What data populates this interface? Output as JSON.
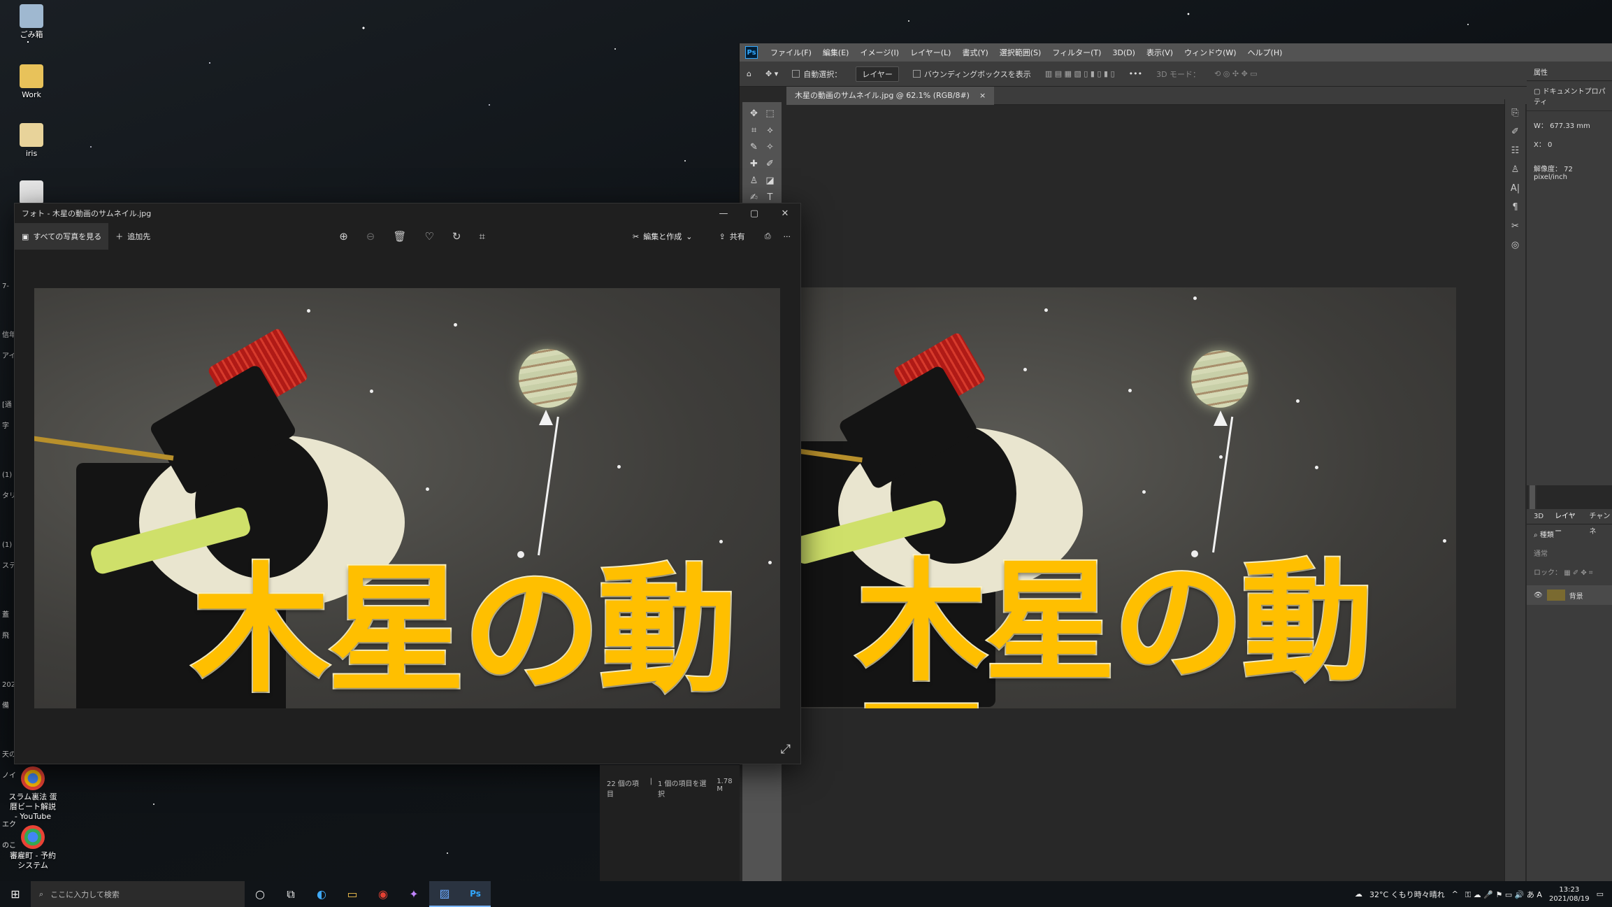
{
  "desktop": {
    "icons": [
      {
        "label": "ごみ箱",
        "icon": "recycle-bin-icon"
      },
      {
        "label": "Work",
        "icon": "folder-icon"
      },
      {
        "label": "iris",
        "icon": "folder-icon"
      },
      {
        "label": "スラム裏法 蛋暦ビート解説 - YouTube",
        "icon": "chrome-icon"
      },
      {
        "label": "審雇町 - 予約システム",
        "icon": "chrome-icon"
      }
    ],
    "left_edge_labels": [
      "7-",
      "信年 アイ",
      "[通 字",
      "(1) タリ",
      "(1) ステ",
      "蓋 飛",
      "202 備",
      "天の ノイ",
      "エク のこ"
    ]
  },
  "photoshop": {
    "menu": [
      "ファイル(F)",
      "編集(E)",
      "イメージ(I)",
      "レイヤー(L)",
      "書式(Y)",
      "選択範囲(S)",
      "フィルター(T)",
      "3D(D)",
      "表示(V)",
      "ウィンドウ(W)",
      "ヘルプ(H)"
    ],
    "options": {
      "auto_select": "自動選択：",
      "layer_select": "レイヤー",
      "bounding_box": "バウンディングボックスを表示",
      "mode_3d": "3D モード："
    },
    "doc_tab": "木星の動画のサムネイル.jpg @ 62.1% (RGB/8#)",
    "properties": {
      "tab": "属性",
      "doc_props": "ドキュメントプロパティ",
      "w": "W： 677.33 mm",
      "x": "X： 0",
      "resolution": "解像度： 72 pixel/inch"
    },
    "layers": {
      "tabs": [
        "3D",
        "レイヤー",
        "チャンネ"
      ],
      "search": "種類",
      "blend": "通常",
      "lock": "ロック：",
      "layer_name": "背景"
    }
  },
  "photos": {
    "title": "フォト - 木星の動画のサムネイル.jpg",
    "all_photos": "すべての写真を見る",
    "add_to": "追加先",
    "edit_create": "編集と作成",
    "share": "共有",
    "more": "···"
  },
  "image": {
    "headline": "木星の動画"
  },
  "explorer_status": {
    "items": "22 個の項目",
    "selected": "1 個の項目を選択",
    "size": "1.78 M"
  },
  "taskbar": {
    "search_placeholder": "ここに入力して検索",
    "weather": "32°C くもり時々晴れ",
    "time": "13:23",
    "date": "2021/08/19"
  }
}
